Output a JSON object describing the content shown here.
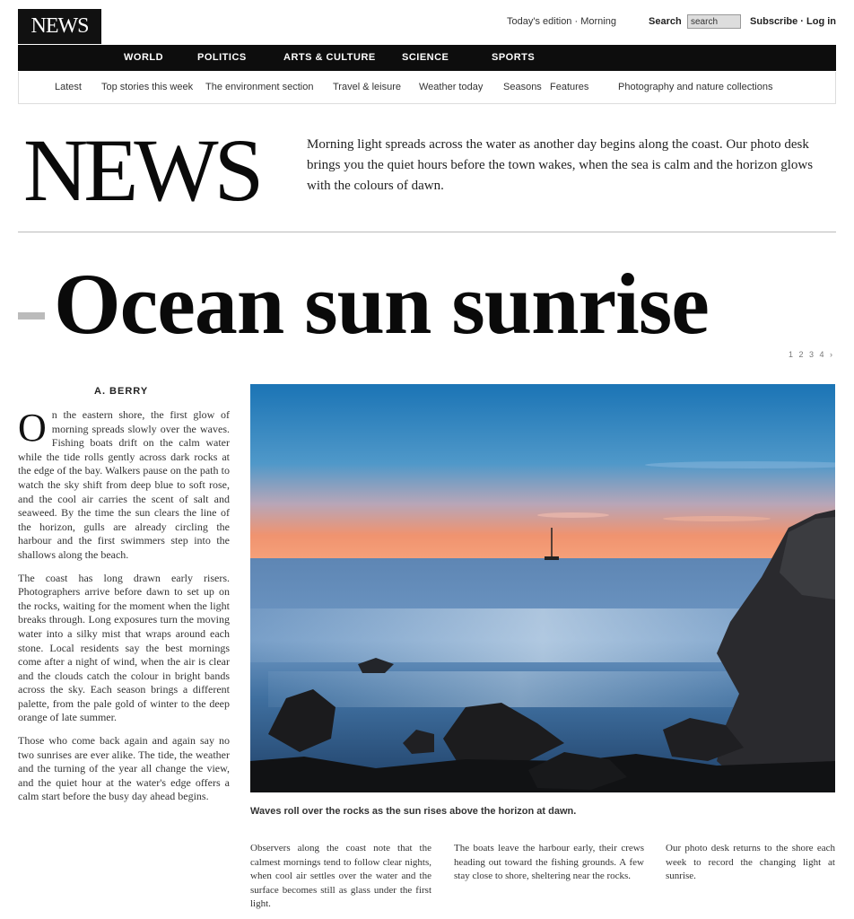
{
  "topbar": {
    "logo": "NEWS",
    "date": "Today's edition · Morning",
    "search_label": "Search",
    "search_value": "search",
    "login": "Subscribe · Log in"
  },
  "nav": {
    "items": [
      "WORLD",
      "POLITICS",
      "ARTS & CULTURE",
      "SCIENCE",
      "SPORTS"
    ]
  },
  "subnav": {
    "items": [
      "Latest",
      "Top stories this week",
      "The environment section",
      "Travel & leisure",
      "Weather today",
      "Seasons",
      "Features",
      "Photography and nature collections"
    ]
  },
  "masthead": {
    "title": "NEWS",
    "intro": "Morning light spreads across the water as another day begins along the coast. Our photo desk brings you the quiet hours before the town wakes, when the sea is calm and the horizon glows with the colours of dawn."
  },
  "headline": "Ocean sun sunrise",
  "pager": "1 2 3 4 ›",
  "article": {
    "byline": "A. BERRY",
    "dropcap": "O",
    "p1": "n the eastern shore, the first glow of morning spreads slowly over the waves. Fishing boats drift on the calm water while the tide rolls gently across dark rocks at the edge of the bay. Walkers pause on the path to watch the sky shift from deep blue to soft rose, and the cool air carries the scent of salt and seaweed. By the time the sun clears the line of the horizon, gulls are already circling the harbour and the first swimmers step into the shallows along the beach.",
    "p2": "The coast has long drawn early risers. Photographers arrive before dawn to set up on the rocks, waiting for the moment when the light breaks through. Long exposures turn the moving water into a silky mist that wraps around each stone. Local residents say the best mornings come after a night of wind, when the air is clear and the clouds catch the colour in bright bands across the sky. Each season brings a different palette, from the pale gold of winter to the deep orange of late summer.",
    "p3": "Those who come back again and again say no two sunrises are ever alike. The tide, the weather and the turning of the year all change the view, and the quiet hour at the water's edge offers a calm start before the busy day ahead begins."
  },
  "photo": {
    "caption": "Waves roll over the rocks as the sun rises above the horizon at dawn."
  },
  "bottom": {
    "col1": "Observers along the coast note that the calmest mornings tend to follow clear nights, when cool air settles over the water and the surface becomes still as glass under the first light.",
    "col2": "The boats leave the harbour early, their crews heading out toward the fishing grounds. A few stay close to shore, sheltering near the rocks.",
    "col3": "Our photo desk returns to the shore each week to record the changing light at sunrise."
  },
  "colors": {
    "nav_bg": "#0d0d0d",
    "sky_top": "#1c76b6",
    "sky_glow": "#f0936f",
    "sea": "#4f7fb4",
    "rock": "#1b1b1d"
  }
}
